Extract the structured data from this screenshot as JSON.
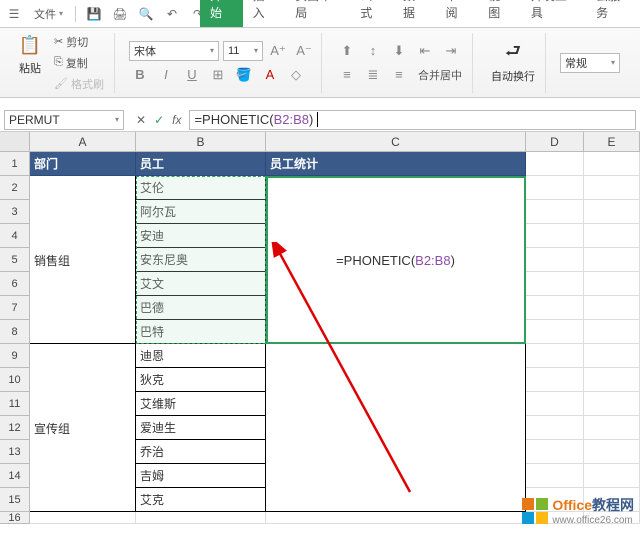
{
  "titlebar": {
    "menu_label": "文件"
  },
  "tabs": {
    "start": "开始",
    "insert": "插入",
    "page_layout": "页面布局",
    "formulas": "公式",
    "data": "数据",
    "review": "审阅",
    "view": "视图",
    "dev": "开发工具",
    "cloud": "云服务"
  },
  "ribbon": {
    "paste": "粘贴",
    "cut": "剪切",
    "copy": "复制",
    "format_painter": "格式刷",
    "font_name": "宋体",
    "font_size": "11",
    "bold": "B",
    "italic": "I",
    "underline": "U",
    "merge": "合并居中",
    "wrap": "自动换行",
    "style": "常规"
  },
  "namebox": "PERMUT",
  "formula_prefix": "=PHONETIC(",
  "formula_ref": "B2:B8",
  "formula_suffix": ")",
  "columns": [
    "A",
    "B",
    "C",
    "D",
    "E"
  ],
  "headers": {
    "A": "部门",
    "B": "员工",
    "C": "员工统计"
  },
  "deptA": "销售组",
  "deptB": "宣传组",
  "empA": [
    "艾伦",
    "阿尔瓦",
    "安迪",
    "安东尼奥",
    "艾文",
    "巴德",
    "巴特"
  ],
  "empB": [
    "迪恩",
    "狄克",
    "艾维斯",
    "爱迪生",
    "乔治",
    "吉姆",
    "艾克"
  ],
  "cell_formula_prefix": "=PHONETIC(",
  "cell_formula_ref": "B2:B8",
  "cell_formula_suffix": ")",
  "watermark": {
    "brand": "Office",
    "suffix": "教程网",
    "url": "www.office26.com"
  }
}
